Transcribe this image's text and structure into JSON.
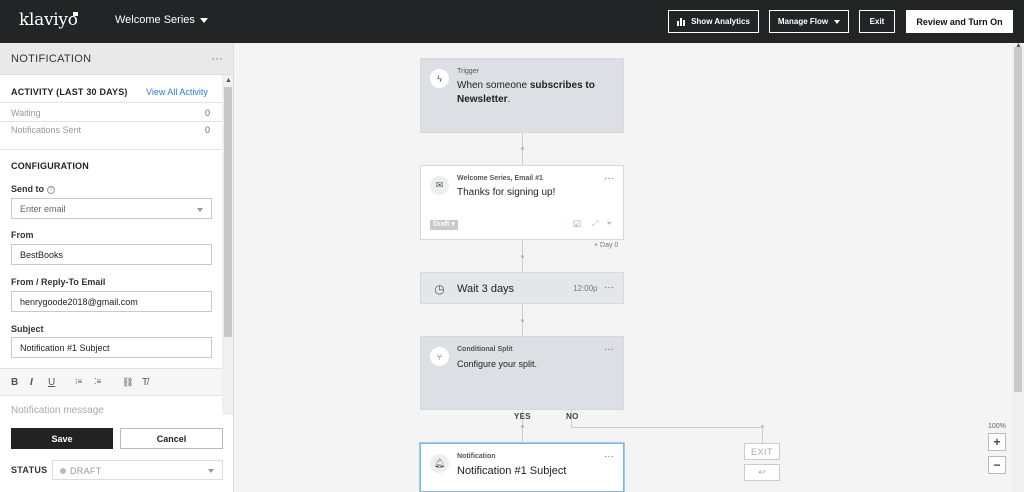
{
  "topbar": {
    "logo": "klaviyo",
    "flow_name": "Welcome Series",
    "show_analytics": "Show Analytics",
    "manage_flow": "Manage Flow",
    "exit": "Exit",
    "review": "Review and Turn On"
  },
  "panel": {
    "title": "NOTIFICATION",
    "more": "···",
    "activity_title": "ACTIVITY (LAST 30 DAYS)",
    "view_all": "View All Activity",
    "stats": [
      {
        "label": "Waiting",
        "value": "0"
      },
      {
        "label": "Notifications Sent",
        "value": "0"
      }
    ],
    "config_title": "CONFIGURATION",
    "send_to_label": "Send to",
    "send_to_placeholder": "Enter email",
    "from_label": "From",
    "from_value": "BestBooks",
    "reply_label": "From / Reply-To Email",
    "reply_value": "henrygoode2018@gmail.com",
    "subject_label": "Subject",
    "subject_value": "Notification #1 Subject",
    "toolbar": {
      "bold": "B",
      "italic": "I",
      "underline": "U",
      "ordered_list": "⁝≡",
      "bullet_list": "⁚≡",
      "link": "⛓",
      "clear_format": "T̸"
    },
    "message_placeholder": "Notification message",
    "save": "Save",
    "cancel": "Cancel",
    "status_label": "STATUS",
    "status_value": "DRAFT"
  },
  "flow": {
    "trigger": {
      "kicker": "Trigger",
      "text_prefix": "When someone ",
      "text_bold": "subscribes to Newsletter",
      "text_suffix": "."
    },
    "email": {
      "kicker": "Welcome Series, Email #1",
      "text": "Thanks for signing up!",
      "tag": "Draft ▾",
      "day": "+ Day 0"
    },
    "wait": {
      "text": "Wait 3 days",
      "time": "12:00p"
    },
    "split": {
      "kicker": "Conditional Split",
      "text": "Configure your split.",
      "yes": "YES",
      "no": "NO"
    },
    "notification": {
      "kicker": "Notification",
      "text": "Notification #1 Subject"
    },
    "exit": "EXIT",
    "zoom": "100%",
    "zoom_in": "+",
    "zoom_out": "−"
  },
  "icons": [
    "bar-chart-icon",
    "caret-down-icon",
    "lightning-icon",
    "mail-icon",
    "clock-icon",
    "split-icon",
    "bell-icon",
    "help-icon"
  ]
}
